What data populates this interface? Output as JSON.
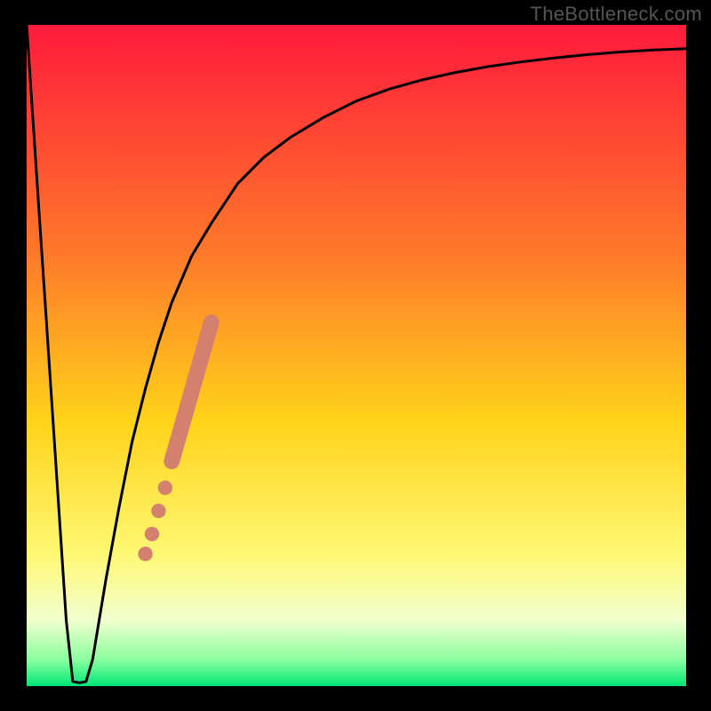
{
  "watermark": "TheBottleneck.com",
  "chart_data": {
    "type": "line",
    "title": "",
    "xlabel": "",
    "ylabel": "",
    "xlim": [
      0,
      100
    ],
    "ylim": [
      0,
      100
    ],
    "grid": false,
    "legend": false,
    "background": {
      "type": "vertical-gradient",
      "stops": [
        {
          "pos": 0.0,
          "color": "#ff1a3c"
        },
        {
          "pos": 0.35,
          "color": "#ff7a2a"
        },
        {
          "pos": 0.6,
          "color": "#ffd31a"
        },
        {
          "pos": 0.8,
          "color": "#fff873"
        },
        {
          "pos": 0.9,
          "color": "#f2ffcf"
        },
        {
          "pos": 0.96,
          "color": "#8bff9e"
        },
        {
          "pos": 1.0,
          "color": "#00e676"
        }
      ]
    },
    "series": [
      {
        "name": "bottleneck-curve",
        "color": "#000000",
        "x": [
          0.0,
          1.0,
          2.0,
          3.0,
          4.0,
          5.0,
          6.0,
          7.0,
          8.0,
          9.0,
          10.0,
          11.0,
          12.0,
          14.0,
          16.0,
          18.0,
          20.0,
          22.0,
          25.0,
          28.0,
          32.0,
          36.0,
          40.0,
          45.0,
          50.0,
          55.0,
          60.0,
          65.0,
          70.0,
          75.0,
          80.0,
          85.0,
          90.0,
          95.0,
          100.0
        ],
        "y": [
          100,
          85,
          70,
          55,
          40,
          25,
          10,
          0.7,
          0.5,
          0.7,
          4,
          10,
          16,
          27,
          37,
          45,
          52,
          58,
          65,
          70,
          76,
          80,
          83,
          86,
          88.5,
          90.3,
          91.7,
          92.8,
          93.7,
          94.4,
          95.0,
          95.5,
          95.9,
          96.2,
          96.4
        ]
      }
    ],
    "highlights": {
      "name": "highlight-segment",
      "color": "#d4806f",
      "points": [
        {
          "x": 18.0,
          "y": 20.0,
          "r": 1.1
        },
        {
          "x": 19.0,
          "y": 23.0,
          "r": 1.1
        },
        {
          "x": 20.0,
          "y": 26.5,
          "r": 1.1
        },
        {
          "x": 21.0,
          "y": 30.0,
          "r": 1.1
        }
      ],
      "thick_segment": {
        "x1": 22.0,
        "y1": 34.0,
        "x2": 28.0,
        "y2": 55.0,
        "width": 2.4
      }
    }
  }
}
